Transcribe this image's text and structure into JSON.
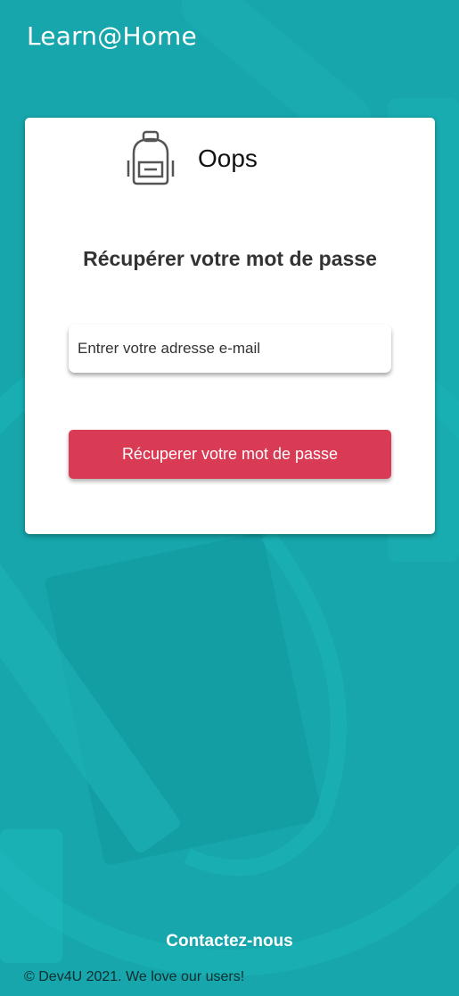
{
  "header": {
    "brand": "Learn@Home"
  },
  "card": {
    "icon": "backpack-icon",
    "title": "Oops",
    "heading": "Récupérer votre mot de passe",
    "email": {
      "placeholder": "Entrer votre adresse e-mail",
      "value": ""
    },
    "submit_label": "Récuperer votre mot de passe"
  },
  "footer": {
    "contact_label": "Contactez-nous",
    "copyright": "© Dev4U 2021. We love our users!"
  },
  "colors": {
    "background": "#16a6ab",
    "accent": "#d93a54",
    "card": "#ffffff"
  }
}
